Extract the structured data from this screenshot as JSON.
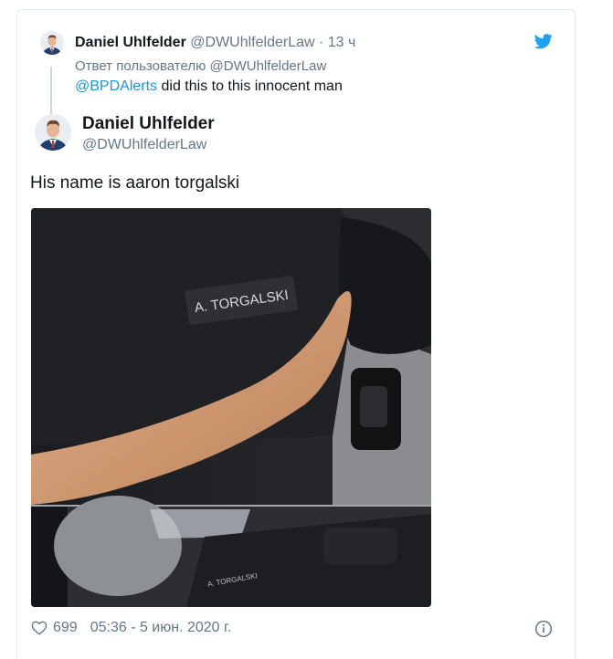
{
  "parent_tweet": {
    "author_name": "Daniel Uhlfelder",
    "author_handle": "@DWUhlfelderLaw",
    "separator": "·",
    "time_ago": "13 ч",
    "reply_to_prefix": "Ответ пользователю",
    "reply_to_handle": "@DWUhlfelderLaw",
    "mention": "@BPDAlerts",
    "text": "did this to this innocent man"
  },
  "main_tweet": {
    "author_name": "Daniel Uhlfelder",
    "author_handle": "@DWUhlfelderLaw",
    "text": "His name is aaron torgalski",
    "media_patch_text": "A. TORGALSKI",
    "media_lower_patch_text": "A. TORGALSKI",
    "like_count": "699",
    "timestamp": "05:36 - 5 июн. 2020 г."
  },
  "icons": {
    "brand": "twitter-bird-icon",
    "like": "heart-icon",
    "info": "info-icon"
  },
  "colors": {
    "twitter_blue": "#1da1f2",
    "link": "#1b95e0",
    "muted_text": "#657786",
    "primary_text": "#14171a",
    "border": "#e1e8ed"
  }
}
